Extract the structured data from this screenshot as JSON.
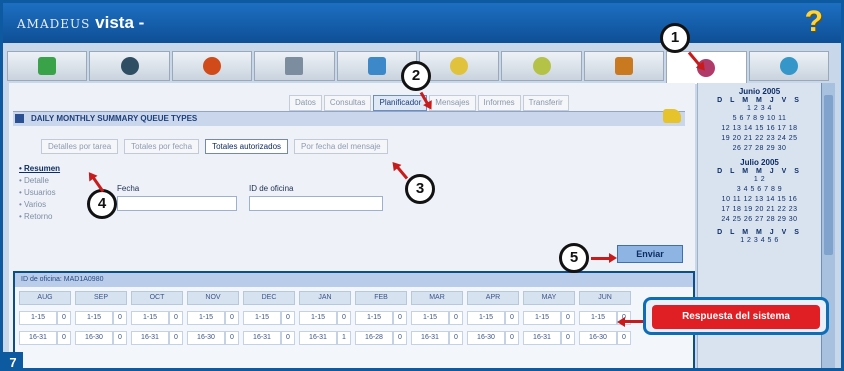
{
  "app": {
    "brand_small": "AMADEUS",
    "brand_main": "vista -",
    "help_icon": "?"
  },
  "toolbar": {
    "icons": [
      "plane-icon",
      "globe-icon",
      "moon-icon",
      "network-icon",
      "car-icon",
      "lamp-icon",
      "coins-icon",
      "bag-icon",
      "phone-icon",
      "earth-icon"
    ]
  },
  "subtabs": [
    "Datos",
    "Consultas",
    "Planificador",
    "Mensajes",
    "Informes",
    "Transferir"
  ],
  "section_title": "DAILY MONTHLY SUMMARY QUEUE TYPES",
  "viewtabs": [
    "Detalles por tarea",
    "Totales por fecha",
    "Totales autorizados",
    "Por fecha del mensaje"
  ],
  "leftnav": [
    "Resumen",
    "Detalle",
    "Usuarios",
    "Varios",
    "Retorno"
  ],
  "form": {
    "label1": "Fecha",
    "label2": "ID de oficina",
    "send_label": "Enviar"
  },
  "calendar": [
    {
      "month": "Junio 2005",
      "days": "D L M M J V S",
      "rows": [
        "1  2  3  4",
        "5  6  7  8  9 10 11",
        "12 13 14 15 16 17 18",
        "19 20 21 22 23 24 25",
        "26 27 28 29 30"
      ]
    },
    {
      "month": "Julio 2005",
      "days": "D L M M J V S",
      "rows": [
        "1  2",
        "3  4  5  6  7  8  9",
        "10 11 12 13 14 15 16",
        "17 18 19 20 21 22 23",
        "24 25 26 27 28 29 30"
      ]
    },
    {
      "month": "",
      "days": "D L M M J V S",
      "rows": [
        "1  2  3  4  5  6"
      ]
    }
  ],
  "response": {
    "header": "ID de oficina: MAD1A0980",
    "months": [
      "AUG",
      "SEP",
      "OCT",
      "NOV",
      "DEC",
      "JAN",
      "FEB",
      "MAR",
      "APR",
      "MAY",
      "JUN"
    ],
    "row1": [
      "1-15",
      "1-15",
      "1-15",
      "1-15",
      "1-15",
      "1-15",
      "1-15",
      "1-15",
      "1-15",
      "1-15",
      "1-15"
    ],
    "row1_vals": [
      "0",
      "0",
      "0",
      "0",
      "0",
      "0",
      "0",
      "0",
      "0",
      "0",
      "0"
    ],
    "row2": [
      "16-31",
      "16-30",
      "16-31",
      "16-30",
      "16-31",
      "16-31",
      "16-28",
      "16-31",
      "16-30",
      "16-31",
      "16-30"
    ],
    "row2_vals": [
      "0",
      "0",
      "0",
      "0",
      "0",
      "1",
      "0",
      "0",
      "0",
      "0",
      "0"
    ]
  },
  "callouts": [
    "1",
    "2",
    "3",
    "4",
    "5",
    "7"
  ],
  "note": "Respuesta del sistema"
}
